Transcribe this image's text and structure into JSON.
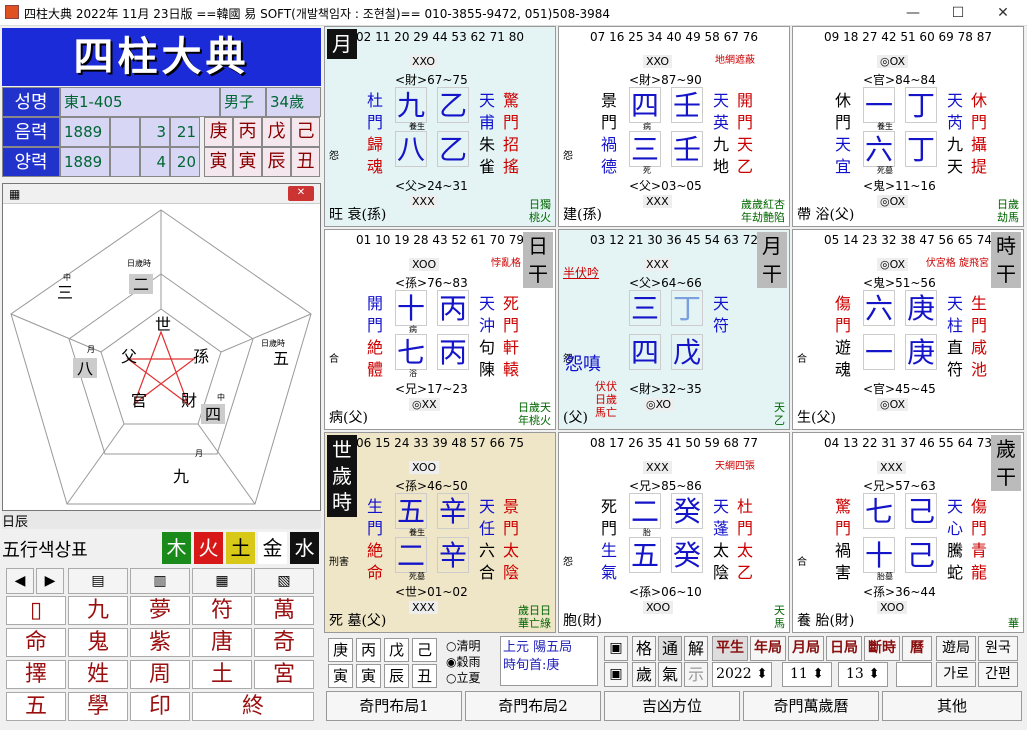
{
  "window": {
    "title": "四柱大典 2022年 11月 23日版 ==韓國 易 SOFT(개발책임자 : 조현철)== 010-3855-9472, 051)508-3984"
  },
  "logo": "四柱大典",
  "info": {
    "name_label": "성명",
    "name": "東1-405",
    "gender": "男子",
    "age": "34歲",
    "lunar_label": "음력",
    "lunar_year": "1889",
    "lunar_month": "3",
    "lunar_day": "21",
    "solar_label": "양력",
    "solar_year": "1889",
    "solar_month": "4",
    "solar_day": "20",
    "stems": [
      "庚",
      "丙",
      "戊",
      "己"
    ],
    "branches": [
      "寅",
      "寅",
      "辰",
      "丑"
    ]
  },
  "pentagon": {
    "center": "世",
    "nodes": [
      "孫",
      "財",
      "官",
      "父"
    ],
    "labels": [
      "二",
      "八",
      "四",
      "五",
      "九",
      "三"
    ],
    "tags": [
      "日歲時",
      "月",
      "中",
      "日歲時",
      "月",
      "中"
    ]
  },
  "under_row": "日辰",
  "ohang": {
    "label": "五行색상표",
    "items": [
      "木",
      "火",
      "土",
      "金",
      "水"
    ],
    "colors": [
      "#1a8a1a",
      "#d81818",
      "#d8c818",
      "#222",
      "#1a2acc"
    ]
  },
  "toolbar": {
    "prev": "◀",
    "next": "▶"
  },
  "keys": [
    "九",
    "夢",
    "符",
    "萬",
    "命",
    "鬼",
    "紫",
    "唐",
    "奇",
    "擇",
    "姓",
    "周",
    "土",
    "宮",
    "五",
    "學",
    "印",
    "終"
  ],
  "palaces": [
    {
      "corner": "月",
      "nums": "02 11 20 29 44 53 62 71 80",
      "top_x": "XXO",
      "top_rel": "<財>67~75",
      "g1": "九",
      "g2": "乙",
      "g3": "八",
      "g4": "乙",
      "left": [
        "杜",
        "門",
        "歸",
        "魂"
      ],
      "right": [
        "天",
        "甫",
        "朱",
        "雀"
      ],
      "far": [
        "驚",
        "門",
        "招",
        "搖"
      ],
      "bot_rel": "<父>24~31",
      "bot_x": "XXX",
      "foot": "旺 衰(孫)",
      "br": "日獨\n桃火",
      "sl1": "養生",
      "sl2": "",
      "side": "怨"
    },
    {
      "corner": "",
      "nums": "07 16 25 34 40 49 58 67 76",
      "top_x": "XXO",
      "top_rel": "<財>87~90",
      "g1": "四",
      "g2": "壬",
      "g3": "三",
      "g4": "壬",
      "left": [
        "景",
        "門",
        "禍",
        "德"
      ],
      "right": [
        "天",
        "英",
        "九",
        "地"
      ],
      "far": [
        "開",
        "門",
        "天",
        "乙"
      ],
      "bot_rel": "<父>03~05",
      "bot_x": "XXX",
      "foot": "建(孫)",
      "br": "歲歲紅杏\n年劫艶陷",
      "sl1": "病",
      "sl2": "死",
      "side": "怨",
      "tr": "地網遮蔽"
    },
    {
      "corner": "",
      "nums": "09 18 27 42 51 60 69 78 87",
      "top_x": "◎OX",
      "top_rel": "<官>84~84",
      "g1": "一",
      "g2": "丁",
      "g3": "六",
      "g4": "丁",
      "left": [
        "休",
        "門",
        "天",
        "宜"
      ],
      "right": [
        "天",
        "芮",
        "九",
        "天"
      ],
      "far": [
        "休",
        "門",
        "攝",
        "提"
      ],
      "bot_rel": "<鬼>11~16",
      "bot_x": "◎OX",
      "foot": "帶 浴(父)",
      "br": "日歲\n劫馬",
      "sl1": "養生",
      "sl2": "死墓",
      "side": ""
    },
    {
      "corner": "",
      "cornerR": "日干",
      "nums": "01 10 19 28 43 52 61 70 79",
      "top_x": "XOO",
      "top_rel": "<孫>76~83",
      "g1": "十",
      "g2": "丙",
      "g3": "七",
      "g4": "丙",
      "left": [
        "開",
        "門",
        "絶",
        "體"
      ],
      "right": [
        "天",
        "沖",
        "句",
        "陳"
      ],
      "far": [
        "死",
        "門",
        "軒",
        "轅"
      ],
      "bot_rel": "<兄>17~23",
      "bot_x": "◎XX",
      "foot": "病(父)",
      "br": "日歲天\n年桃火",
      "sl1": "病",
      "sl2": "浴",
      "side": "合",
      "tr": "悖亂格"
    },
    {
      "corner": "",
      "cornerR": "月干",
      "nums": "03 12 21 30 36 45 54 63 72",
      "top_x": "XXX",
      "top_rel": "<父>64~66",
      "g1": "三",
      "g2": "丁",
      "g3": "四",
      "g4": "戊",
      "left": [
        "",
        "",
        "",
        ""
      ],
      "right": [
        "天",
        "符",
        "",
        ""
      ],
      "far": [
        "",
        "",
        "",
        ""
      ],
      "bot_rel": "<財>32~35",
      "bot_x": "◎XO",
      "foot": "(父)",
      "br": "天\n乙",
      "sl1": "",
      "sl2": "",
      "side": "怨",
      "tr": "",
      "tl": "半伏吟",
      "mid": "怨嗔",
      "bl": "伏伏\n日歲\n馬亡"
    },
    {
      "corner": "",
      "cornerR": "時干",
      "nums": "05 14 23 32 38 47 56 65 74",
      "top_x": "◎OX",
      "top_rel": "<鬼>51~56",
      "g1": "六",
      "g2": "庚",
      "g3": "一",
      "g4": "庚",
      "left": [
        "傷",
        "門",
        "遊",
        "魂"
      ],
      "right": [
        "天",
        "柱",
        "直",
        "符"
      ],
      "far": [
        "生",
        "門",
        "咸",
        "池"
      ],
      "bot_rel": "<官>45~45",
      "bot_x": "◎OX",
      "foot": "生(父)",
      "br": "",
      "sl1": "",
      "sl2": "",
      "side": "合",
      "tr": "伏宮格\n旋飛宮"
    },
    {
      "corner": "世歲時",
      "nums": "06 15 24 33 39 48 57 66 75",
      "top_x": "XOO",
      "top_rel": "<孫>46~50",
      "g1": "五",
      "g2": "辛",
      "g3": "二",
      "g4": "辛",
      "left": [
        "生",
        "門",
        "絶",
        "命"
      ],
      "right": [
        "天",
        "任",
        "六",
        "合"
      ],
      "far": [
        "景",
        "門",
        "太",
        "陰"
      ],
      "bot_rel": "<世>01~02",
      "bot_x": "XXX",
      "foot": "死 墓(父)",
      "br": "歲日日\n華亡綠",
      "sl1": "養生",
      "sl2": "死墓",
      "side": "刑害"
    },
    {
      "corner": "",
      "nums": "08 17 26 35 41 50 59 68 77",
      "top_x": "XXX",
      "top_rel": "<兄>85~86",
      "g1": "二",
      "g2": "癸",
      "g3": "五",
      "g4": "癸",
      "left": [
        "死",
        "門",
        "生",
        "氣"
      ],
      "right": [
        "天",
        "蓬",
        "太",
        "陰"
      ],
      "far": [
        "杜",
        "門",
        "太",
        "乙"
      ],
      "bot_rel": "<孫>06~10",
      "bot_x": "XOO",
      "foot": "胞(財)",
      "br": "天\n馬",
      "sl1": "胎",
      "sl2": "",
      "side": "怨",
      "tr": "天網四張"
    },
    {
      "corner": "",
      "cornerR": "歲干",
      "nums": "04 13 22 31 37 46 55 64 73",
      "top_x": "XXX",
      "top_rel": "<兄>57~63",
      "g1": "七",
      "g2": "己",
      "g3": "十",
      "g4": "己",
      "left": [
        "驚",
        "門",
        "禍",
        "害"
      ],
      "right": [
        "天",
        "心",
        "騰",
        "蛇"
      ],
      "far": [
        "傷",
        "門",
        "青",
        "龍"
      ],
      "bot_rel": "<孫>36~44",
      "bot_x": "XOO",
      "foot": "養 胎(財)",
      "br": "華",
      "sl1": "",
      "sl2": "胎墓",
      "side": "合"
    }
  ],
  "bottom": {
    "ganji": [
      "庚",
      "丙",
      "戊",
      "己",
      "寅",
      "寅",
      "辰",
      "丑"
    ],
    "radio": [
      "清明",
      "穀雨",
      "立夏"
    ],
    "yuan": "上元 陽五局",
    "shi": "時旬首:庚",
    "btns1": [
      "格",
      "通",
      "解",
      "歲",
      "氣",
      "示"
    ],
    "btns2": [
      "平生",
      "年局",
      "月局",
      "日局",
      "斷時",
      "曆"
    ],
    "btns3": [
      "遊局",
      "원국",
      "가로",
      "간편"
    ],
    "year": "2022",
    "month": "11",
    "day": "13",
    "menu": [
      "奇門布局1",
      "奇門布局2",
      "吉凶方位",
      "奇門萬歲曆",
      "其他"
    ]
  }
}
